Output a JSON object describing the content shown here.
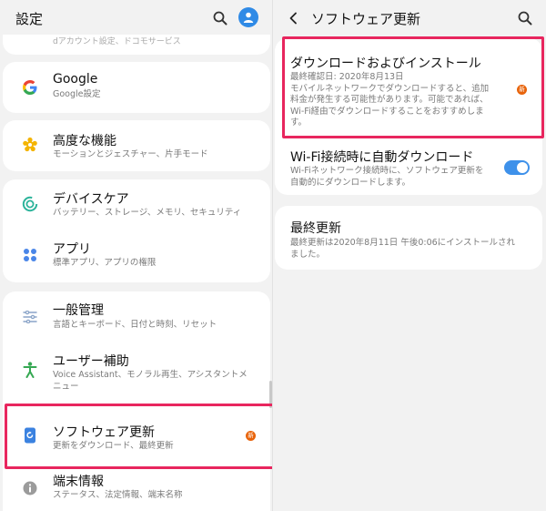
{
  "left": {
    "title": "設定",
    "top_partial_text": "dアカウント設定、ドコモサービス",
    "groups": [
      {
        "items": [
          {
            "title": "Google",
            "subtitle": "Google設定",
            "icon": "google-icon"
          }
        ]
      },
      {
        "items": [
          {
            "title": "高度な機能",
            "subtitle": "モーションとジェスチャー、片手モード",
            "icon": "advanced-features-icon"
          }
        ]
      },
      {
        "items": [
          {
            "title": "デバイスケア",
            "subtitle": "バッテリー、ストレージ、メモリ、セキュリティ",
            "icon": "device-care-icon"
          },
          {
            "title": "アプリ",
            "subtitle": "標準アプリ、アプリの権限",
            "icon": "apps-icon"
          }
        ]
      },
      {
        "items": [
          {
            "title": "一般管理",
            "subtitle": "言語とキーボード、日付と時刻、リセット",
            "icon": "general-management-icon"
          },
          {
            "title": "ユーザー補助",
            "subtitle": "Voice Assistant、モノラル再生、アシスタントメ",
            "subtitle2": "ニュー",
            "icon": "accessibility-icon"
          },
          {
            "title": "ソフトウェア更新",
            "subtitle": "更新をダウンロード、最終更新",
            "icon": "software-update-icon",
            "badge": "新"
          },
          {
            "title": "端末情報",
            "subtitle": "ステータス、法定情報、端末名称",
            "icon": "info-icon"
          }
        ]
      }
    ]
  },
  "right": {
    "title": "ソフトウェア更新",
    "download": {
      "title": "ダウンロードおよびインストール",
      "lines": [
        "最終確認日: 2020年8月13日",
        "モバイルネットワークでダウンロードすると、追加",
        "料金が発生する可能性があります。可能であれば、",
        "Wi-Fi経由でダウンロードすることをおすすめしま",
        "す。"
      ],
      "badge": "新"
    },
    "wifi_auto": {
      "title": "Wi-Fi接続時に自動ダウンロード",
      "lines": [
        "Wi-Fiネットワーク接続時に、ソフトウェア更新を",
        "自動的にダウンロードします。"
      ],
      "enabled": true
    },
    "last_update": {
      "title": "最終更新",
      "lines": [
        "最終更新は2020年8月11日 午後0:06にインストールされ",
        "ました。"
      ]
    }
  },
  "colors": {
    "background": "#f2f2f2",
    "card": "#ffffff",
    "highlight": "#e8265e",
    "badge": "#e8630a",
    "toggle": "#3e91ea",
    "profile": "#2f8ae6"
  }
}
